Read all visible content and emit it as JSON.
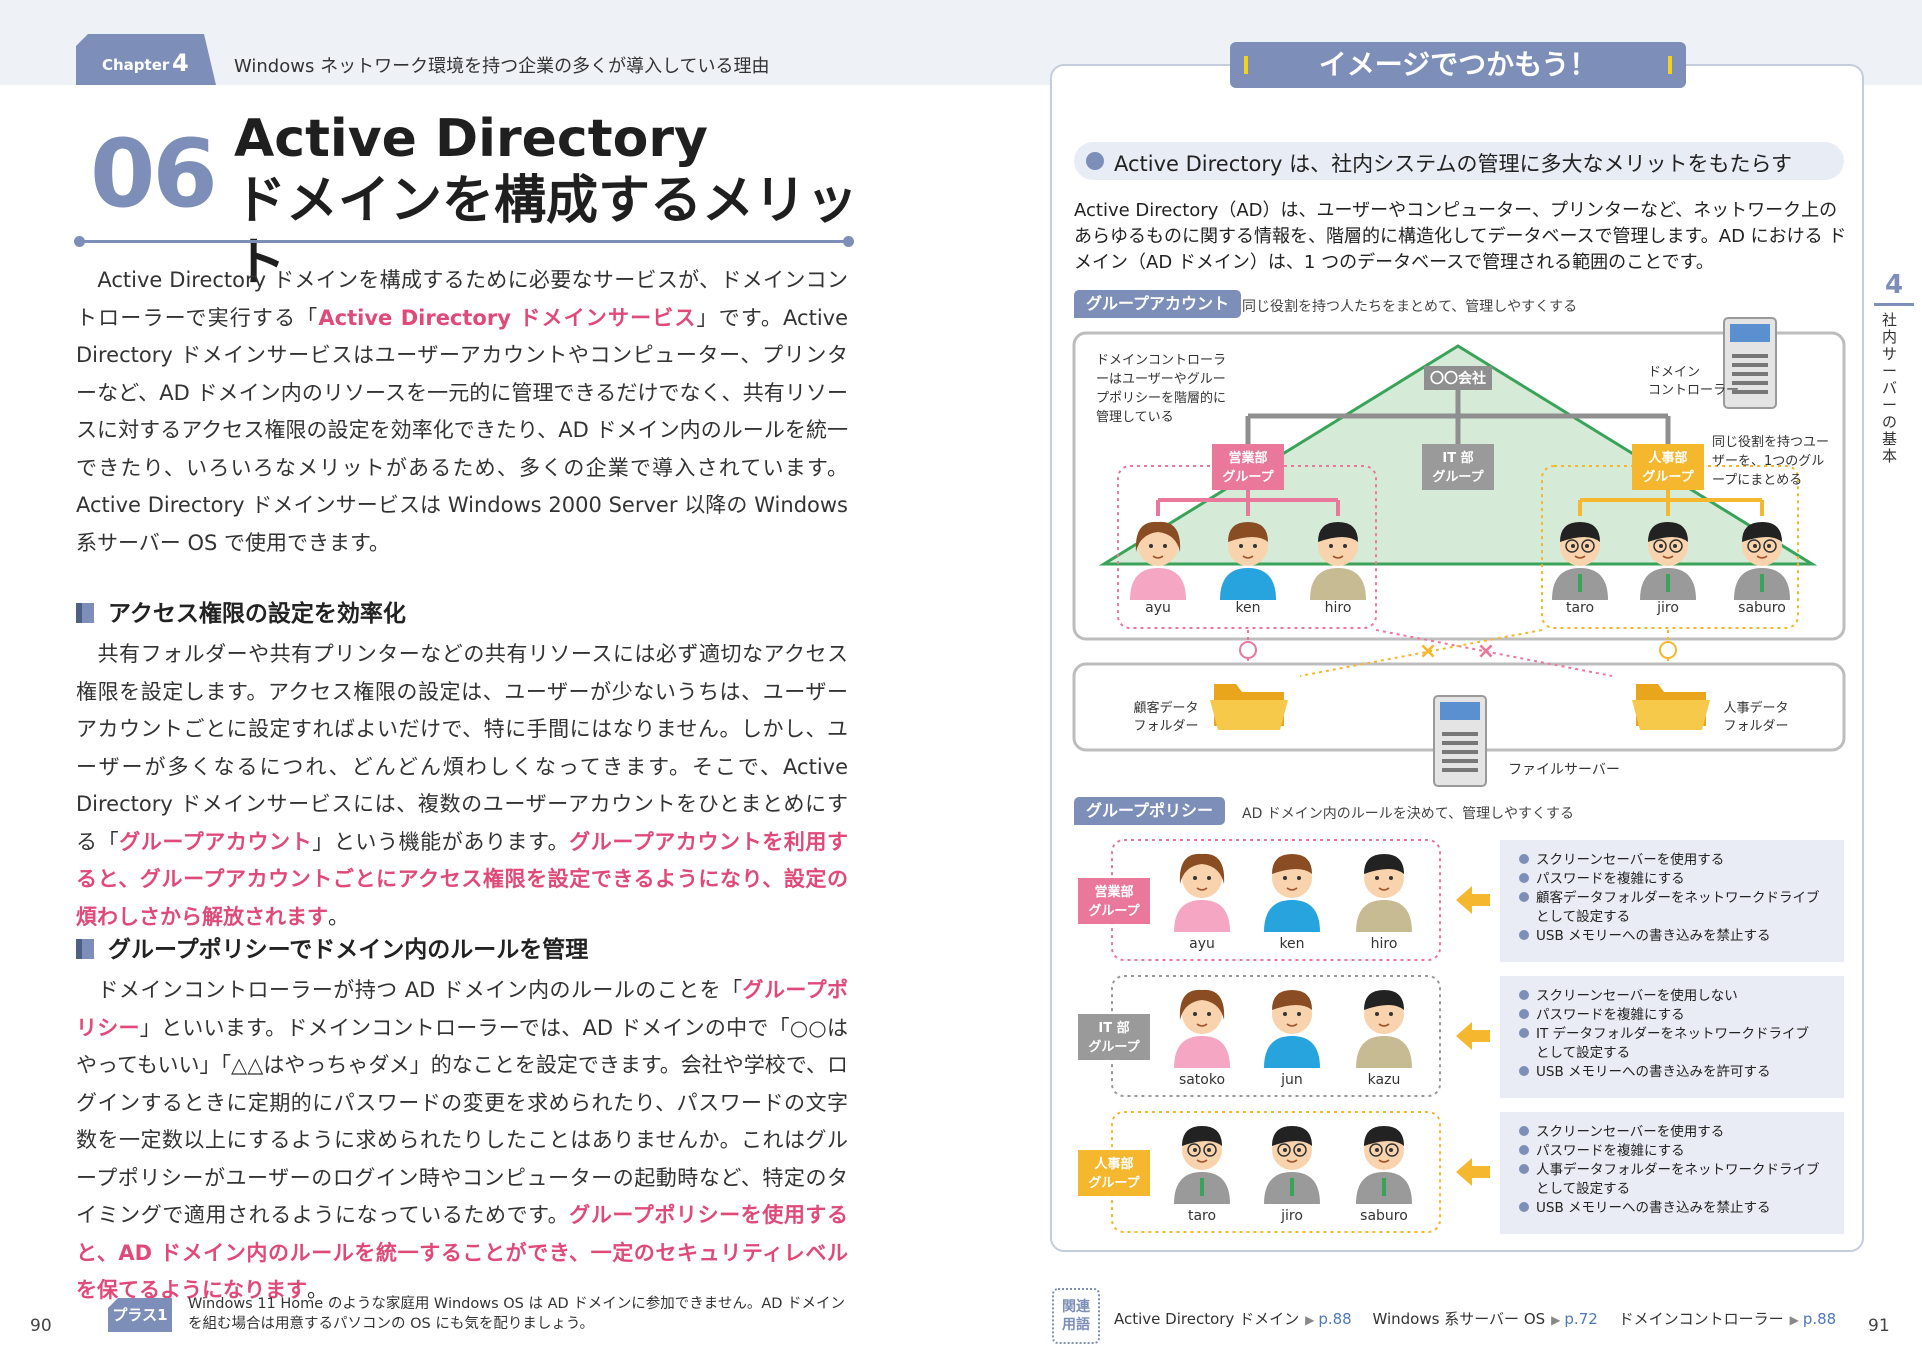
{
  "left": {
    "chapter_label": "Chapter",
    "chapter_num": "4",
    "chapter_title": "Windows ネットワーク環境を持つ企業の多くが導入している理由",
    "section_num": "06",
    "title_line1": "Active Directory",
    "title_line2": "ドメインを構成するメリット",
    "p1_a": "Active Directory ドメインを構成するために必要なサービスが、ドメインコントローラーで実行する「",
    "p1_em": "Active Directory ドメインサービス",
    "p1_b": "」です。Active Directory ドメインサービスはユーザーアカウントやコンピューター、プリンターなど、AD ドメイン内のリソースを一元的に管理できるだけでなく、共有リソースに対するアクセス権限の設定を効率化できたり、AD ドメイン内のルールを統一できたり、いろいろなメリットがあるため、多くの企業で導入されています。Active Directory ドメインサービスは Windows 2000 Server 以降の Windows 系サーバー OS で使用できます。",
    "h1": "アクセス権限の設定を効率化",
    "p2_a": "共有フォルダーや共有プリンターなどの共有リソースには必ず適切なアクセス権限を設定します。アクセス権限の設定は、ユーザーが少ないうちは、ユーザーアカウントごとに設定すればよいだけで、特に手間にはなりません。しかし、ユーザーが多くなるにつれ、どんどん煩わしくなってきます。そこで、Active Directory ドメインサービスには、複数のユーザーアカウントをひとまとめにする「",
    "p2_em1": "グループアカウント",
    "p2_b": "」という機能があります。",
    "p2_em2": "グループアカウントを利用すると、グループアカウントごとにアクセス権限を設定できるようになり、設定の煩わしさから解放されます",
    "p2_c": "。",
    "h2": "グループポリシーでドメイン内のルールを管理",
    "p3_a": "ドメインコントローラーが持つ AD ドメイン内のルールのことを「",
    "p3_em1": "グループポリシー",
    "p3_b": "」といいます。ドメインコントローラーでは、AD ドメインの中で「○○はやってもいい」「△△はやっちゃダメ」的なことを設定できます。会社や学校で、ログインするときに定期的にパスワードの変更を求められたり、パスワードの文字数を一定数以上にするように求められたりしたことはありませんか。これはグループポリシーがユーザーのログイン時やコンピューターの起動時など、特定のタイミングで適用されるようになっているためです。",
    "p3_em2": "グループポリシーを使用すると、AD ドメイン内のルールを統一することができ、一定のセキュリティレベルを保てるようになります",
    "p3_c": "。",
    "plus_label": "プラス1",
    "plus_text": "Windows 11 Home のような家庭用 Windows OS は AD ドメインに参加できません。AD ドメインを組む場合は用意するパソコンの OS にも気を配りましょう。",
    "page": "90"
  },
  "right": {
    "banner": "イメージでつかもう！",
    "headline": "Active Directory は、社内システムの管理に多大なメリットをもたらす",
    "intro": "Active Directory（AD）は、ユーザーやコンピューター、プリンターなど、ネットワーク上のあらゆるものに関する情報を、階層的に構造化してデータベースで管理します。AD における ドメイン（AD ドメイン）は、1 つのデータベースで管理される範囲のことです。",
    "side_num": "4",
    "side_text": "社内サーバーの基本",
    "tag1": "グループアカウント",
    "tag1_desc": "同じ役割を持つ人たちをまとめて、管理しやすくする",
    "dc_note": [
      "ドメインコントローラ",
      "ーはユーザーやグルー",
      "プポリシーを階層的に",
      "管理している"
    ],
    "company": "〇〇会社",
    "dc_label": [
      "ドメイン",
      "コントローラー"
    ],
    "group_note": [
      "同じ役割を持つユー",
      "ザーを、1つのグル",
      "ープにまとめる"
    ],
    "groups": [
      {
        "line1": "営業部",
        "line2": "グループ",
        "color": "#e9789b"
      },
      {
        "line1": "IT 部",
        "line2": "グループ",
        "color": "#9a9a9a"
      },
      {
        "line1": "人事部",
        "line2": "グループ",
        "color": "#f4b72e"
      }
    ],
    "top_users_left": [
      "ayu",
      "ken",
      "hiro"
    ],
    "top_users_right": [
      "taro",
      "jiro",
      "saburo"
    ],
    "folder_left": [
      "顧客データ",
      "フォルダー"
    ],
    "folder_right": [
      "人事データ",
      "フォルダー"
    ],
    "file_server": "ファイルサーバー",
    "tag2": "グループポリシー",
    "tag2_desc": "AD ドメイン内のルールを決めて、管理しやすくする",
    "policy_rows": [
      {
        "users": [
          "ayu",
          "ken",
          "hiro"
        ],
        "rules": [
          "スクリーンセーバーを使用する",
          "パスワードを複雑にする",
          "顧客データフォルダーをネットワークドライブ",
          "として設定する",
          "USB メモリーへの書き込みを禁止する"
        ]
      },
      {
        "users": [
          "satoko",
          "jun",
          "kazu"
        ],
        "rules": [
          "スクリーンセーバーを使用しない",
          "パスワードを複雑にする",
          "IT データフォルダーをネットワークドライブ",
          "として設定する",
          "USB メモリーへの書き込みを許可する"
        ]
      },
      {
        "users": [
          "taro",
          "jiro",
          "saburo"
        ],
        "rules": [
          "スクリーンセーバーを使用する",
          "パスワードを複雑にする",
          "人事データフォルダーをネットワークドライブ",
          "として設定する",
          "USB メモリーへの書き込みを禁止する"
        ]
      }
    ],
    "related_label_1": "関連",
    "related_label_2": "用語",
    "related": [
      {
        "term": "Active Directory ドメイン",
        "ref": "p.88"
      },
      {
        "term": "Windows 系サーバー OS",
        "ref": "p.72"
      },
      {
        "term": "ドメインコントローラー",
        "ref": "p.88"
      }
    ],
    "page": "91"
  }
}
